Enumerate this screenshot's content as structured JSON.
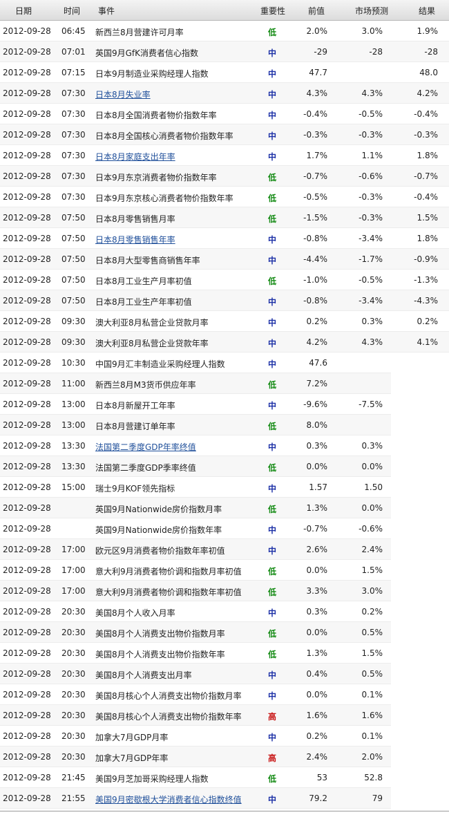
{
  "header": {
    "date": "日期",
    "time": "时间",
    "event": "事件",
    "importance": "重要性",
    "previous": "前值",
    "forecast": "市场预测",
    "result": "结果"
  },
  "rows": [
    {
      "date": "2012-09-28",
      "time": "06:45",
      "event": "新西兰8月营建许可月率",
      "imp": "低",
      "level": "low",
      "prev": "2.0%",
      "fc": "3.0%",
      "res": "1.9%",
      "link": false
    },
    {
      "date": "2012-09-28",
      "time": "07:01",
      "event": "英国9月GfK消费者信心指数",
      "imp": "中",
      "level": "mid",
      "prev": "-29",
      "fc": "-28",
      "res": "-28",
      "link": false
    },
    {
      "date": "2012-09-28",
      "time": "07:15",
      "event": "日本9月制造业采购经理人指数",
      "imp": "中",
      "level": "mid",
      "prev": "47.7",
      "fc": "",
      "res": "48.0",
      "link": false
    },
    {
      "date": "2012-09-28",
      "time": "07:30",
      "event": "日本8月失业率",
      "imp": "中",
      "level": "mid",
      "prev": "4.3%",
      "fc": "4.3%",
      "res": "4.2%",
      "link": true
    },
    {
      "date": "2012-09-28",
      "time": "07:30",
      "event": "日本8月全国消费者物价指数年率",
      "imp": "中",
      "level": "mid",
      "prev": "-0.4%",
      "fc": "-0.5%",
      "res": "-0.4%",
      "link": false
    },
    {
      "date": "2012-09-28",
      "time": "07:30",
      "event": "日本8月全国核心消费者物价指数年率",
      "imp": "中",
      "level": "mid",
      "prev": "-0.3%",
      "fc": "-0.3%",
      "res": "-0.3%",
      "link": false
    },
    {
      "date": "2012-09-28",
      "time": "07:30",
      "event": "日本8月家庭支出年率",
      "imp": "中",
      "level": "mid",
      "prev": "1.7%",
      "fc": "1.1%",
      "res": "1.8%",
      "link": true
    },
    {
      "date": "2012-09-28",
      "time": "07:30",
      "event": "日本9月东京消费者物价指数年率",
      "imp": "低",
      "level": "low",
      "prev": "-0.7%",
      "fc": "-0.6%",
      "res": "-0.7%",
      "link": false
    },
    {
      "date": "2012-09-28",
      "time": "07:30",
      "event": "日本9月东京核心消费者物价指数年率",
      "imp": "低",
      "level": "low",
      "prev": "-0.5%",
      "fc": "-0.3%",
      "res": "-0.4%",
      "link": false
    },
    {
      "date": "2012-09-28",
      "time": "07:50",
      "event": "日本8月零售销售月率",
      "imp": "低",
      "level": "low",
      "prev": "-1.5%",
      "fc": "-0.3%",
      "res": "1.5%",
      "link": false
    },
    {
      "date": "2012-09-28",
      "time": "07:50",
      "event": "日本8月零售销售年率",
      "imp": "中",
      "level": "mid",
      "prev": "-0.8%",
      "fc": "-3.4%",
      "res": "1.8%",
      "link": true
    },
    {
      "date": "2012-09-28",
      "time": "07:50",
      "event": "日本8月大型零售商销售年率",
      "imp": "中",
      "level": "mid",
      "prev": "-4.4%",
      "fc": "-1.7%",
      "res": "-0.9%",
      "link": false
    },
    {
      "date": "2012-09-28",
      "time": "07:50",
      "event": "日本8月工业生产月率初值",
      "imp": "低",
      "level": "low",
      "prev": "-1.0%",
      "fc": "-0.5%",
      "res": "-1.3%",
      "link": false
    },
    {
      "date": "2012-09-28",
      "time": "07:50",
      "event": "日本8月工业生产年率初值",
      "imp": "中",
      "level": "mid",
      "prev": "-0.8%",
      "fc": "-3.4%",
      "res": "-4.3%",
      "link": false
    },
    {
      "date": "2012-09-28",
      "time": "09:30",
      "event": "澳大利亚8月私营企业贷款月率",
      "imp": "中",
      "level": "mid",
      "prev": "0.2%",
      "fc": "0.3%",
      "res": "0.2%",
      "link": false
    },
    {
      "date": "2012-09-28",
      "time": "09:30",
      "event": "澳大利亚8月私营企业贷款年率",
      "imp": "中",
      "level": "mid",
      "prev": "4.2%",
      "fc": "4.3%",
      "res": "4.1%",
      "link": false
    },
    {
      "date": "2012-09-28",
      "time": "10:30",
      "event": "中国9月汇丰制造业采购经理人指数",
      "imp": "中",
      "level": "mid",
      "prev": "47.6",
      "fc": "",
      "res": "",
      "link": false
    },
    {
      "date": "2012-09-28",
      "time": "11:00",
      "event": "新西兰8月M3货币供应年率",
      "imp": "低",
      "level": "low",
      "prev": "7.2%",
      "fc": "",
      "res": "",
      "link": false
    },
    {
      "date": "2012-09-28",
      "time": "13:00",
      "event": "日本8月新屋开工年率",
      "imp": "中",
      "level": "mid",
      "prev": "-9.6%",
      "fc": "-7.5%",
      "res": "",
      "link": false
    },
    {
      "date": "2012-09-28",
      "time": "13:00",
      "event": "日本8月营建订单年率",
      "imp": "低",
      "level": "low",
      "prev": "8.0%",
      "fc": "",
      "res": "",
      "link": false
    },
    {
      "date": "2012-09-28",
      "time": "13:30",
      "event": "法国第二季度GDP年率终值",
      "imp": "中",
      "level": "mid",
      "prev": "0.3%",
      "fc": "0.3%",
      "res": "",
      "link": true
    },
    {
      "date": "2012-09-28",
      "time": "13:30",
      "event": "法国第二季度GDP季率终值",
      "imp": "低",
      "level": "low",
      "prev": "0.0%",
      "fc": "0.0%",
      "res": "",
      "link": false
    },
    {
      "date": "2012-09-28",
      "time": "15:00",
      "event": "瑞士9月KOF领先指标",
      "imp": "中",
      "level": "mid",
      "prev": "1.57",
      "fc": "1.50",
      "res": "",
      "link": false
    },
    {
      "date": "2012-09-28",
      "time": "",
      "event": "英国9月Nationwide房价指数月率",
      "imp": "低",
      "level": "low",
      "prev": "1.3%",
      "fc": "0.0%",
      "res": "",
      "link": false
    },
    {
      "date": "2012-09-28",
      "time": "",
      "event": "英国9月Nationwide房价指数年率",
      "imp": "中",
      "level": "mid",
      "prev": "-0.7%",
      "fc": "-0.6%",
      "res": "",
      "link": false
    },
    {
      "date": "2012-09-28",
      "time": "17:00",
      "event": "欧元区9月消费者物价指数年率初值",
      "imp": "中",
      "level": "mid",
      "prev": "2.6%",
      "fc": "2.4%",
      "res": "",
      "link": false
    },
    {
      "date": "2012-09-28",
      "time": "17:00",
      "event": "意大利9月消费者物价调和指数月率初值",
      "imp": "低",
      "level": "low",
      "prev": "0.0%",
      "fc": "1.5%",
      "res": "",
      "link": false
    },
    {
      "date": "2012-09-28",
      "time": "17:00",
      "event": "意大利9月消费者物价调和指数年率初值",
      "imp": "低",
      "level": "low",
      "prev": "3.3%",
      "fc": "3.0%",
      "res": "",
      "link": false
    },
    {
      "date": "2012-09-28",
      "time": "20:30",
      "event": "美国8月个人收入月率",
      "imp": "中",
      "level": "mid",
      "prev": "0.3%",
      "fc": "0.2%",
      "res": "",
      "link": false
    },
    {
      "date": "2012-09-28",
      "time": "20:30",
      "event": "美国8月个人消费支出物价指数月率",
      "imp": "低",
      "level": "low",
      "prev": "0.0%",
      "fc": "0.5%",
      "res": "",
      "link": false
    },
    {
      "date": "2012-09-28",
      "time": "20:30",
      "event": "美国8月个人消费支出物价指数年率",
      "imp": "低",
      "level": "low",
      "prev": "1.3%",
      "fc": "1.5%",
      "res": "",
      "link": false
    },
    {
      "date": "2012-09-28",
      "time": "20:30",
      "event": "美国8月个人消费支出月率",
      "imp": "中",
      "level": "mid",
      "prev": "0.4%",
      "fc": "0.5%",
      "res": "",
      "link": false
    },
    {
      "date": "2012-09-28",
      "time": "20:30",
      "event": "美国8月核心个人消费支出物价指数月率",
      "imp": "中",
      "level": "mid",
      "prev": "0.0%",
      "fc": "0.1%",
      "res": "",
      "link": false
    },
    {
      "date": "2012-09-28",
      "time": "20:30",
      "event": "美国8月核心个人消费支出物价指数年率",
      "imp": "高",
      "level": "high",
      "prev": "1.6%",
      "fc": "1.6%",
      "res": "",
      "link": false
    },
    {
      "date": "2012-09-28",
      "time": "20:30",
      "event": "加拿大7月GDP月率",
      "imp": "中",
      "level": "mid",
      "prev": "0.2%",
      "fc": "0.1%",
      "res": "",
      "link": false
    },
    {
      "date": "2012-09-28",
      "time": "20:30",
      "event": "加拿大7月GDP年率",
      "imp": "高",
      "level": "high",
      "prev": "2.4%",
      "fc": "2.0%",
      "res": "",
      "link": false
    },
    {
      "date": "2012-09-28",
      "time": "21:45",
      "event": "美国9月芝加哥采购经理人指数",
      "imp": "低",
      "level": "low",
      "prev": "53",
      "fc": "52.8",
      "res": "",
      "link": false
    },
    {
      "date": "2012-09-28",
      "time": "21:55",
      "event": "美国9月密歇根大学消费者信心指数终值",
      "imp": "中",
      "level": "mid",
      "prev": "79.2",
      "fc": "79",
      "res": "",
      "link": true
    }
  ],
  "colors": {
    "low": "#138a13",
    "mid": "#1b2fa6",
    "high": "#c81414",
    "link": "#1f4f9a"
  }
}
